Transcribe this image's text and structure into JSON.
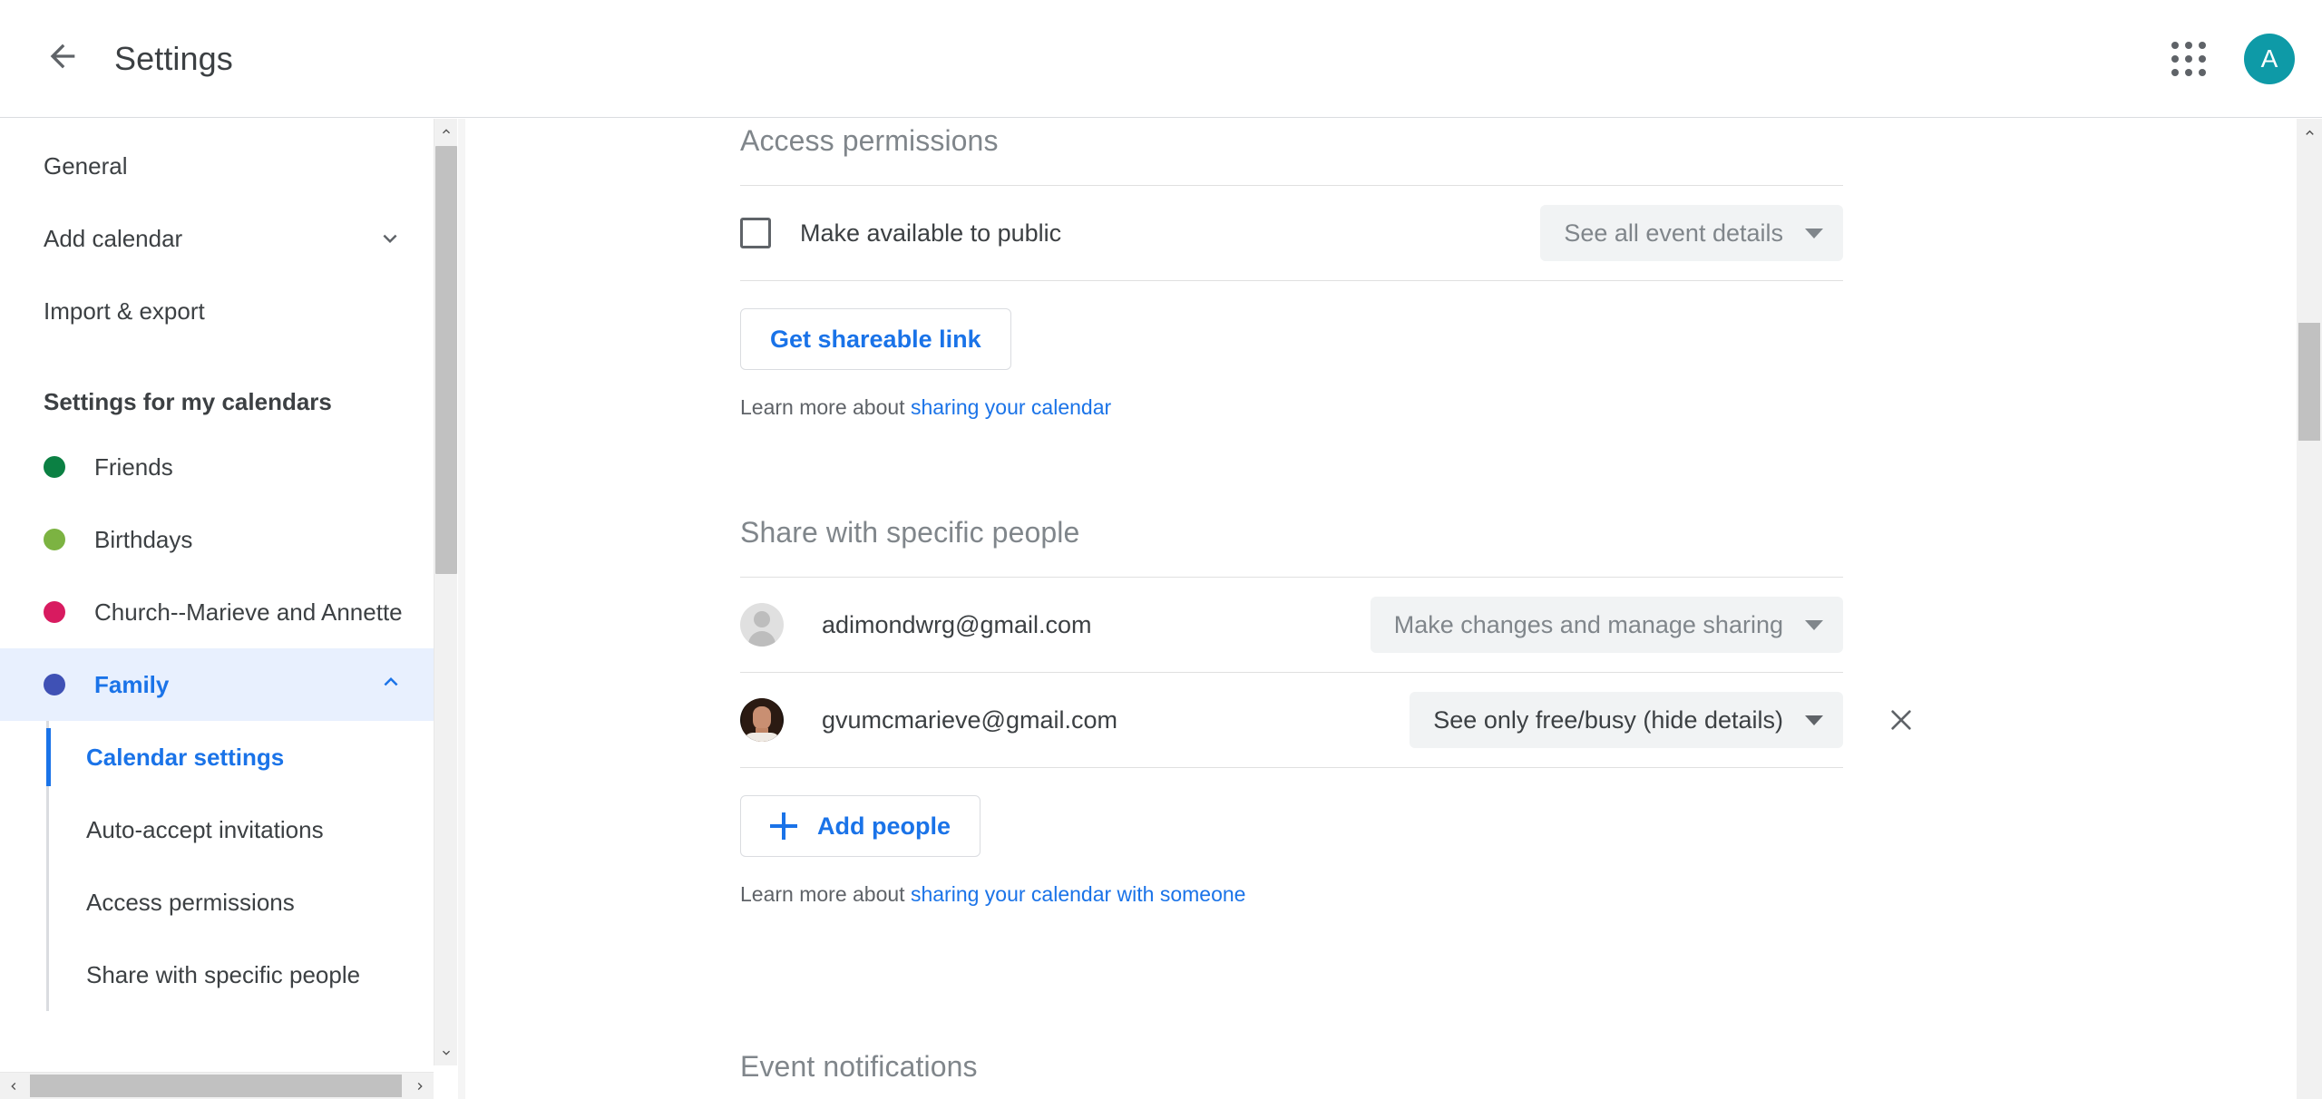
{
  "header": {
    "back_icon": "arrow-back-icon",
    "title": "Settings",
    "apps_icon": "google-apps-grid-icon",
    "avatar_initial": "A"
  },
  "sidebar": {
    "nav": [
      {
        "label": "General",
        "has_chevron": false
      },
      {
        "label": "Add calendar",
        "has_chevron": true,
        "chevron": "chevron-down-icon"
      },
      {
        "label": "Import & export",
        "has_chevron": false
      }
    ],
    "section_heading": "Settings for my calendars",
    "calendars": [
      {
        "label": "Friends",
        "color": "#0b8043",
        "selected": false
      },
      {
        "label": "Birthdays",
        "color": "#7cb342",
        "selected": false
      },
      {
        "label": "Church--Marieve and Annette",
        "color": "#d81b60",
        "selected": false
      },
      {
        "label": "Family",
        "color": "#3f51b5",
        "selected": true,
        "chevron": "chevron-up-icon"
      }
    ],
    "sub_items": [
      {
        "label": "Calendar settings",
        "active": true
      },
      {
        "label": "Auto-accept invitations",
        "active": false
      },
      {
        "label": "Access permissions",
        "active": false
      },
      {
        "label": "Share with specific people",
        "active": false
      }
    ]
  },
  "main": {
    "access_permissions": {
      "title": "Access permissions",
      "public_checkbox_label": "Make available to public",
      "public_checkbox_checked": false,
      "visibility_select": "See all event details",
      "visibility_select_enabled": false,
      "shareable_link_button": "Get shareable link",
      "learn_more_prefix": "Learn more about",
      "learn_more_link": "sharing your calendar"
    },
    "share_with_people": {
      "title": "Share with specific people",
      "people": [
        {
          "email": "adimondwrg@gmail.com",
          "avatar": "generic-person-avatar",
          "permission": "Make changes and manage sharing",
          "permission_enabled": false,
          "removable": false
        },
        {
          "email": "gvumcmarieve@gmail.com",
          "avatar": "photo-avatar",
          "permission": "See only free/busy (hide details)",
          "permission_enabled": true,
          "removable": true,
          "remove_icon": "close-icon"
        }
      ],
      "add_people_button": "Add people",
      "add_icon": "plus-icon",
      "learn_more_prefix": "Learn more about",
      "learn_more_link": "sharing your calendar with someone"
    },
    "event_notifications": {
      "title": "Event notifications"
    }
  },
  "colors": {
    "accent_blue": "#1a73e8",
    "selected_bg": "#e8f0fe",
    "avatar_teal": "#0e9aa7",
    "muted_text": "#80868b"
  },
  "scrollbars": {
    "sidebar_up_icon": "chevron-up-icon",
    "sidebar_down_icon": "chevron-down-icon",
    "hscroll_left_icon": "chevron-left-icon",
    "hscroll_right_icon": "chevron-right-icon",
    "window_up_icon": "chevron-up-icon"
  }
}
